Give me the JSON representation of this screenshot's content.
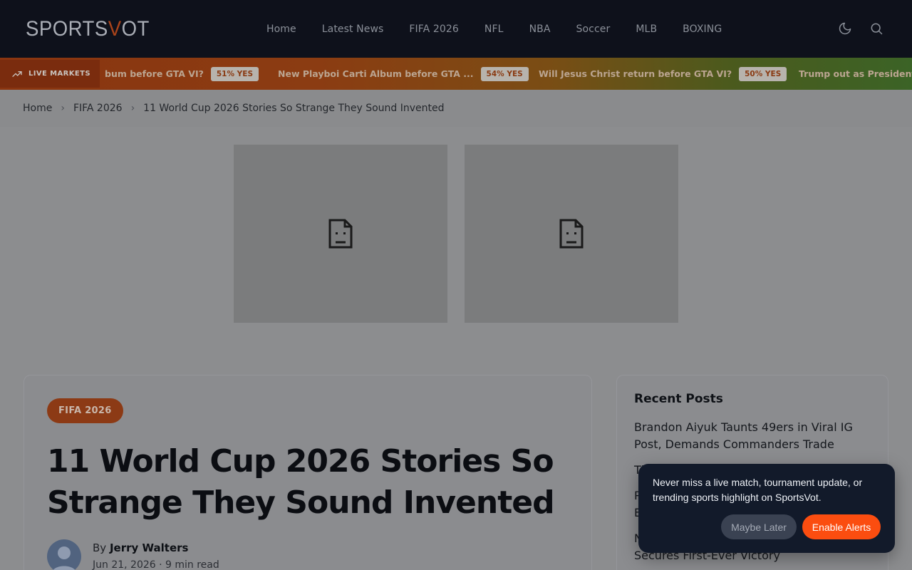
{
  "site": {
    "logo_main": "SPORTS",
    "logo_accent": "V",
    "logo_tail": "OT"
  },
  "nav": [
    "Home",
    "Latest News",
    "FIFA 2026",
    "NFL",
    "NBA",
    "Soccer",
    "MLB",
    "BOXING"
  ],
  "ticker": {
    "label": "LIVE MARKETS",
    "items": [
      {
        "text": "bum before GTA VI?",
        "pill": "51% YES"
      },
      {
        "text": "New Playboi Carti Album before GTA ...",
        "pill": "54% YES"
      },
      {
        "text": "Will Jesus Christ return before GTA VI?",
        "pill": "50% YES"
      },
      {
        "text": "Trump out as President",
        "pill": ""
      }
    ]
  },
  "breadcrumb": {
    "home": "Home",
    "category": "FIFA 2026",
    "current": "11 World Cup 2026 Stories So Strange They Sound Invented"
  },
  "article": {
    "category": "FIFA 2026",
    "title": "11 World Cup 2026 Stories So Strange They Sound Invented",
    "by": "By",
    "author": "Jerry Walters",
    "meta": "Jun 21, 2026 · 9 min read"
  },
  "sidebar": {
    "heading": "Recent Posts",
    "posts": [
      "Brandon Aiyuk Taunts 49ers in Viral IG Post, Demands Commanders Trade",
      "Th",
      "P",
      "E",
      "N",
      "Secures First-Ever Victory"
    ]
  },
  "notification": {
    "message": "Never miss a live match, tournament update, or trending sports highlight on SportsVot.",
    "later": "Maybe Later",
    "enable": "Enable Alerts"
  },
  "colors": {
    "accent": "#fb4d10",
    "header_bg": "#0e111b",
    "notify_bg": "#121a2a"
  }
}
